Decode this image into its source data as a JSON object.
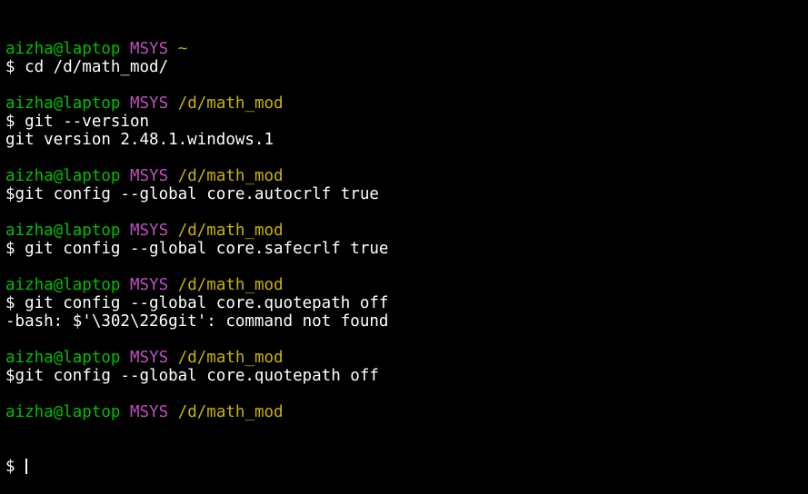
{
  "colors": {
    "background": "#000000",
    "user_host": "#00c000",
    "msystem": "#c050c0",
    "cwd": "#c8b400",
    "text": "#ffffff"
  },
  "lines": [
    {
      "type": "prompt",
      "user": "aizha@laptop",
      "sys": "MSYS",
      "path": "~"
    },
    {
      "type": "command",
      "text": "$ cd /d/math_mod/"
    },
    {
      "type": "blank",
      "text": ""
    },
    {
      "type": "prompt",
      "user": "aizha@laptop",
      "sys": "MSYS",
      "path": "/d/math_mod"
    },
    {
      "type": "command",
      "text": "$ git --version"
    },
    {
      "type": "output",
      "text": "git version 2.48.1.windows.1"
    },
    {
      "type": "blank",
      "text": ""
    },
    {
      "type": "prompt",
      "user": "aizha@laptop",
      "sys": "MSYS",
      "path": "/d/math_mod"
    },
    {
      "type": "command",
      "text": "$git config --global core.autocrlf true"
    },
    {
      "type": "blank",
      "text": ""
    },
    {
      "type": "prompt",
      "user": "aizha@laptop",
      "sys": "MSYS",
      "path": "/d/math_mod"
    },
    {
      "type": "command",
      "text": "$ git config --global core.safecrlf true"
    },
    {
      "type": "blank",
      "text": ""
    },
    {
      "type": "prompt",
      "user": "aizha@laptop",
      "sys": "MSYS",
      "path": "/d/math_mod"
    },
    {
      "type": "command",
      "text": "$ git config --global core.quotepath off"
    },
    {
      "type": "output",
      "text": "-bash: $'\\302\\226git': command not found"
    },
    {
      "type": "blank",
      "text": ""
    },
    {
      "type": "prompt",
      "user": "aizha@laptop",
      "sys": "MSYS",
      "path": "/d/math_mod"
    },
    {
      "type": "command",
      "text": "$git config --global core.quotepath off"
    },
    {
      "type": "blank",
      "text": ""
    },
    {
      "type": "prompt",
      "user": "aizha@laptop",
      "sys": "MSYS",
      "path": "/d/math_mod"
    }
  ],
  "active_prompt": "$ "
}
